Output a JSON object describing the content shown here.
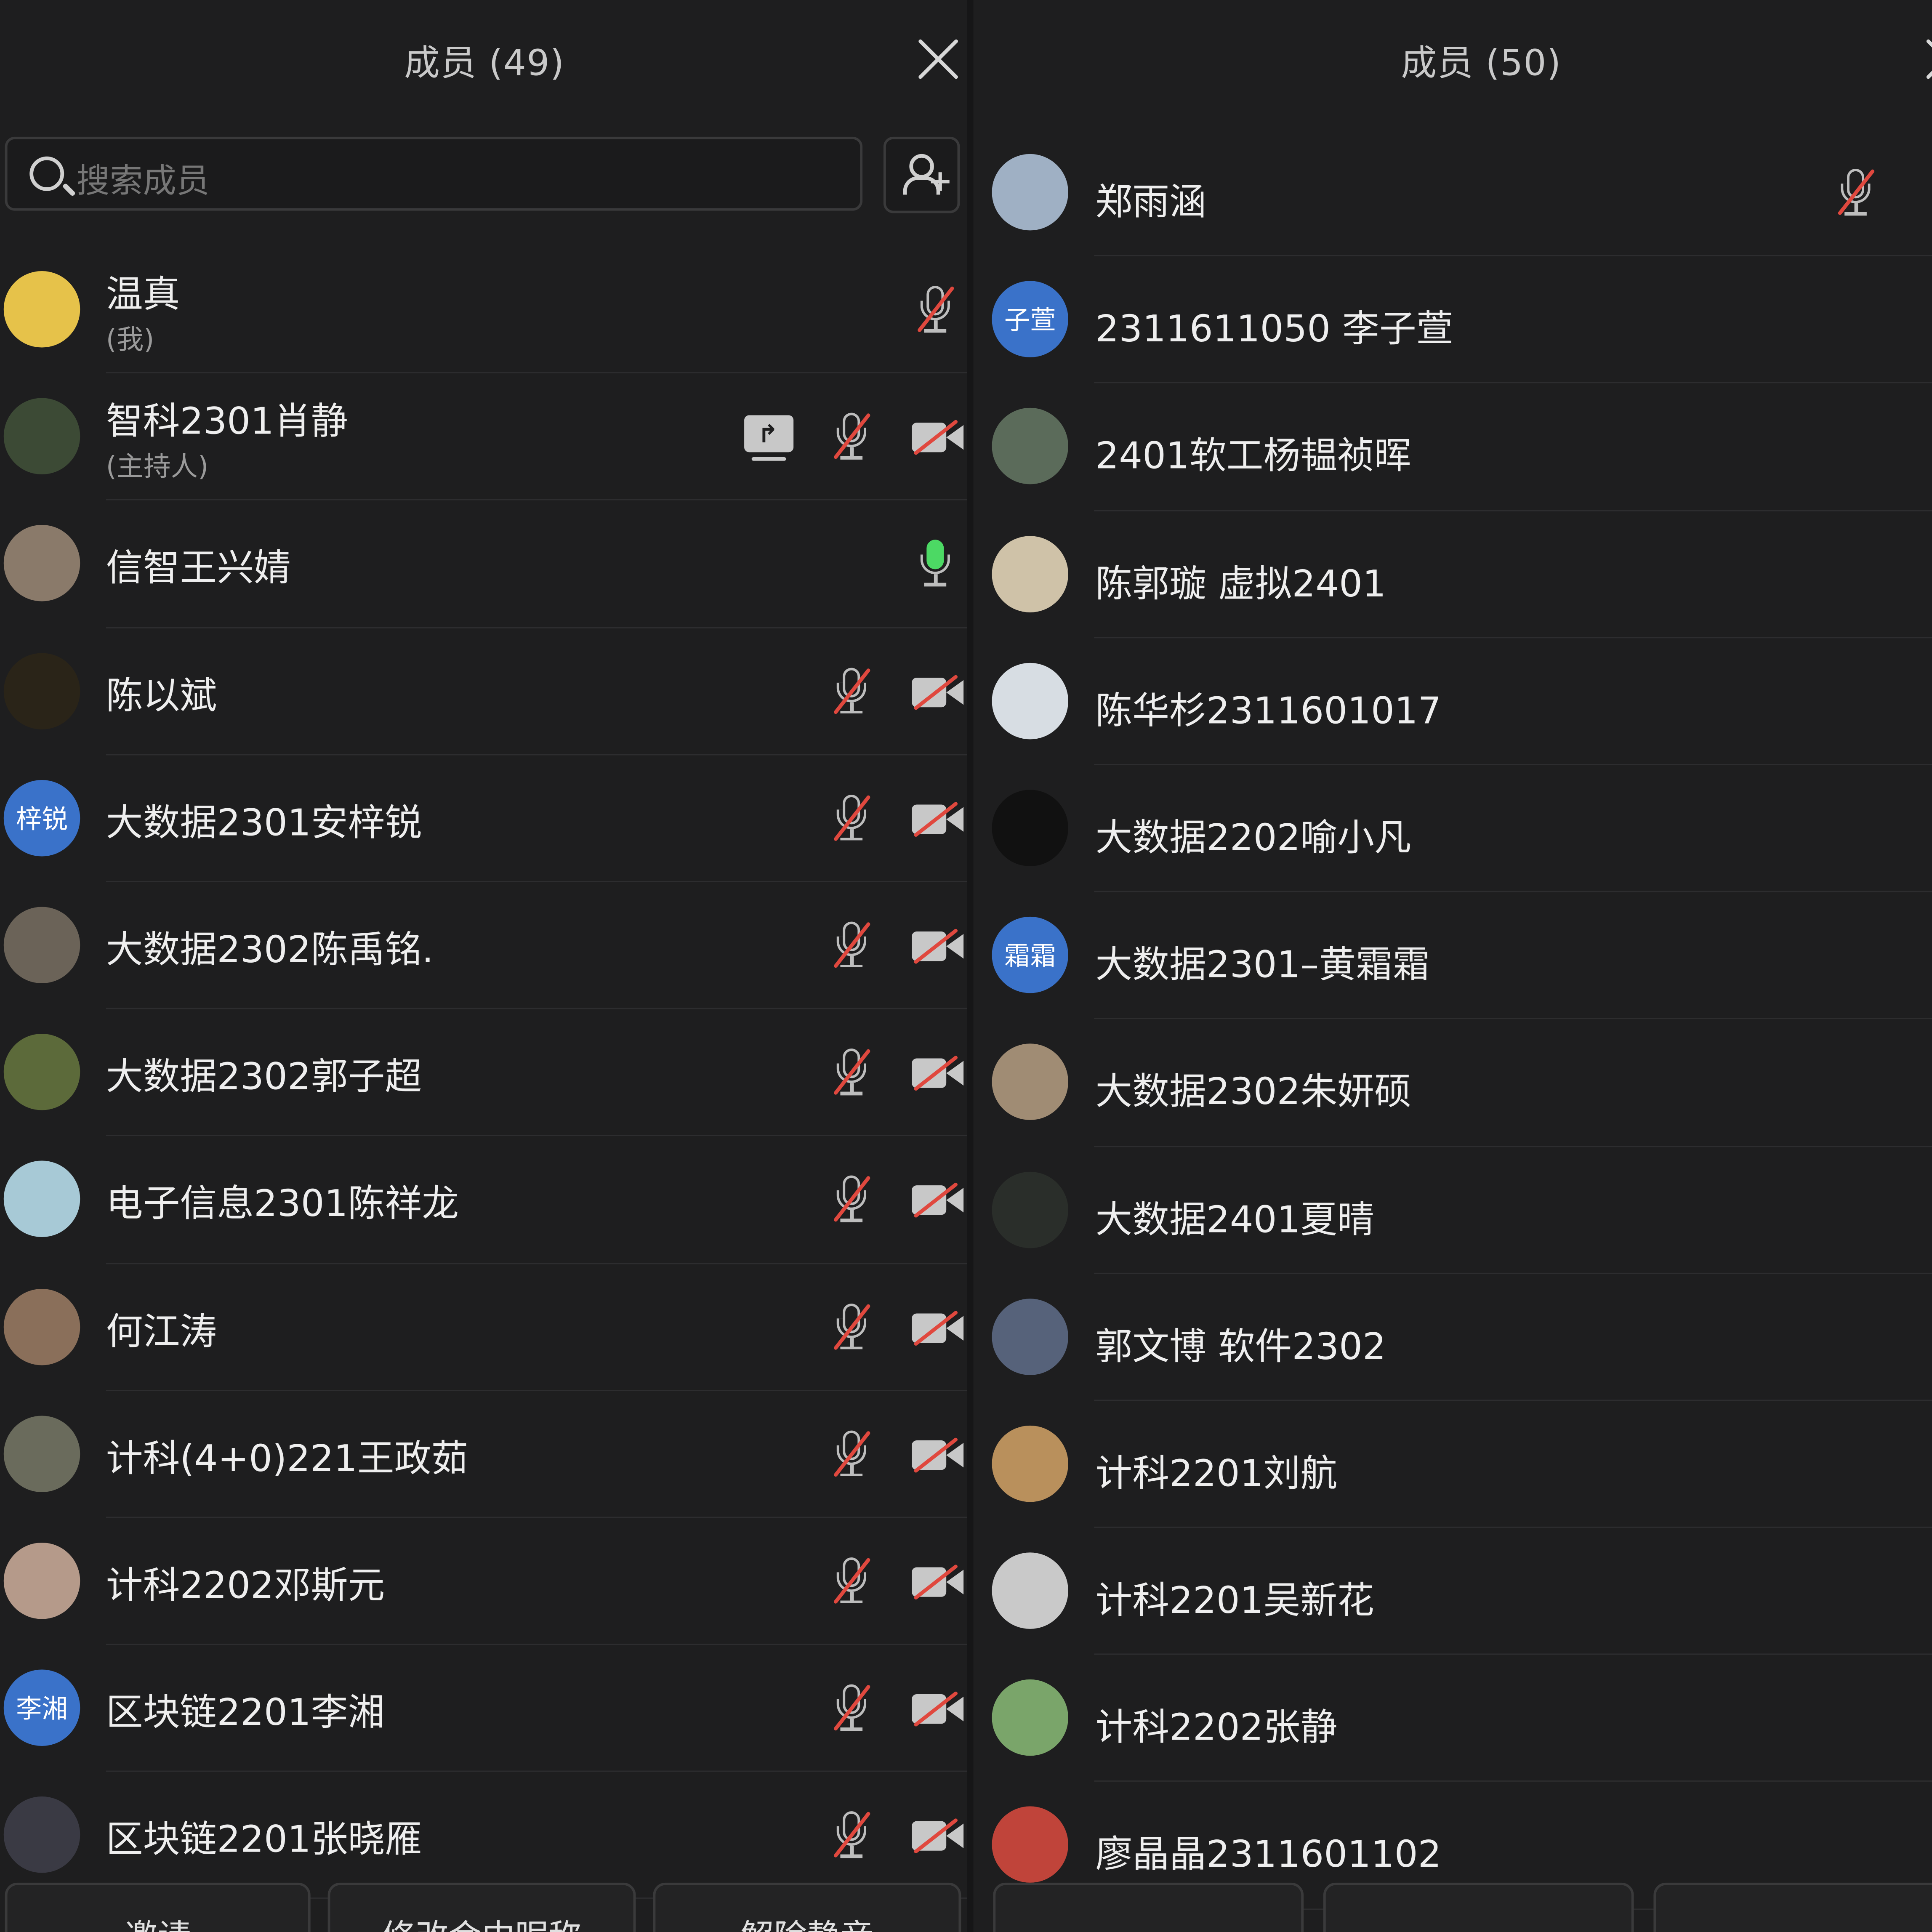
{
  "left": {
    "title": "成员 (49)",
    "search_placeholder": "搜索成员",
    "members": [
      {
        "name": "温真",
        "role": "(我)",
        "avatar": "",
        "avatar_color": "#e6c24a",
        "mic": "muted",
        "cam": false,
        "share": false
      },
      {
        "name": "智科2301肖静",
        "role": "(主持人)",
        "avatar": "",
        "avatar_color": "#3c4a35",
        "mic": "muted",
        "cam": true,
        "share": true
      },
      {
        "name": "信智王兴婧",
        "role": "",
        "avatar": "",
        "avatar_color": "#8a7a6a",
        "mic": "on",
        "cam": false,
        "share": false
      },
      {
        "name": "陈以斌",
        "role": "",
        "avatar": "",
        "avatar_color": "#2a2418",
        "mic": "muted",
        "cam": true,
        "share": false
      },
      {
        "name": "大数据2301安梓锐",
        "role": "",
        "avatar": "梓锐",
        "avatar_color": "#3a72c9",
        "mic": "muted",
        "cam": true,
        "share": false
      },
      {
        "name": "大数据2302陈禹铭.",
        "role": "",
        "avatar": "",
        "avatar_color": "#6b6358",
        "mic": "muted",
        "cam": true,
        "share": false
      },
      {
        "name": "大数据2302郭子超",
        "role": "",
        "avatar": "",
        "avatar_color": "#5c6a3a",
        "mic": "muted",
        "cam": true,
        "share": false
      },
      {
        "name": "电子信息2301陈祥龙",
        "role": "",
        "avatar": "",
        "avatar_color": "#a7c9d6",
        "mic": "muted",
        "cam": true,
        "share": false
      },
      {
        "name": "何江涛",
        "role": "",
        "avatar": "",
        "avatar_color": "#8a6f5a",
        "mic": "muted",
        "cam": true,
        "share": false
      },
      {
        "name": "计科(4+0)221王政茹",
        "role": "",
        "avatar": "",
        "avatar_color": "#6a6b5c",
        "mic": "muted",
        "cam": true,
        "share": false
      },
      {
        "name": "计科2202邓斯元",
        "role": "",
        "avatar": "",
        "avatar_color": "#b59a8a",
        "mic": "muted",
        "cam": true,
        "share": false
      },
      {
        "name": "区块链2201李湘",
        "role": "",
        "avatar": "李湘",
        "avatar_color": "#3a72c9",
        "mic": "muted",
        "cam": true,
        "share": false
      },
      {
        "name": "区块链2201张晓雁",
        "role": "",
        "avatar": "",
        "avatar_color": "#3a3a44",
        "mic": "muted",
        "cam": true,
        "share": false
      }
    ],
    "buttons": [
      "邀请",
      "修改会中昵称",
      "解除静音"
    ]
  },
  "right": {
    "title": "成员 (50)",
    "members": [
      {
        "name": "郑雨涵",
        "avatar": "",
        "avatar_color": "#9fb0c4"
      },
      {
        "name": "2311611050 李子萱",
        "avatar": "子萱",
        "avatar_color": "#3a72c9"
      },
      {
        "name": "2401软工杨韫祯晖",
        "avatar": "",
        "avatar_color": "#5b6b5a"
      },
      {
        "name": "陈郭璇 虚拟2401",
        "avatar": "",
        "avatar_color": "#cfc2a8"
      },
      {
        "name": "陈华杉2311601017",
        "avatar": "",
        "avatar_color": "#d7dde3"
      },
      {
        "name": "大数据2202喻小凡",
        "avatar": "",
        "avatar_color": "#111111"
      },
      {
        "name": "大数据2301–黄霜霜",
        "avatar": "霜霜",
        "avatar_color": "#3a72c9"
      },
      {
        "name": "大数据2302朱妍硕",
        "avatar": "",
        "avatar_color": "#a08c74"
      },
      {
        "name": "大数据2401夏晴",
        "avatar": "",
        "avatar_color": "#2a2e2a"
      },
      {
        "name": "郭文博 软件2302",
        "avatar": "",
        "avatar_color": "#56627a"
      },
      {
        "name": "计科2201刘航",
        "avatar": "",
        "avatar_color": "#b9905c"
      },
      {
        "name": "计科2201吴新花",
        "avatar": "",
        "avatar_color": "#c9c9c9"
      },
      {
        "name": "计科2202张静",
        "avatar": "",
        "avatar_color": "#7aa56a"
      },
      {
        "name": "廖晶晶2311601102",
        "avatar": "",
        "avatar_color": "#c0443a"
      }
    ]
  }
}
